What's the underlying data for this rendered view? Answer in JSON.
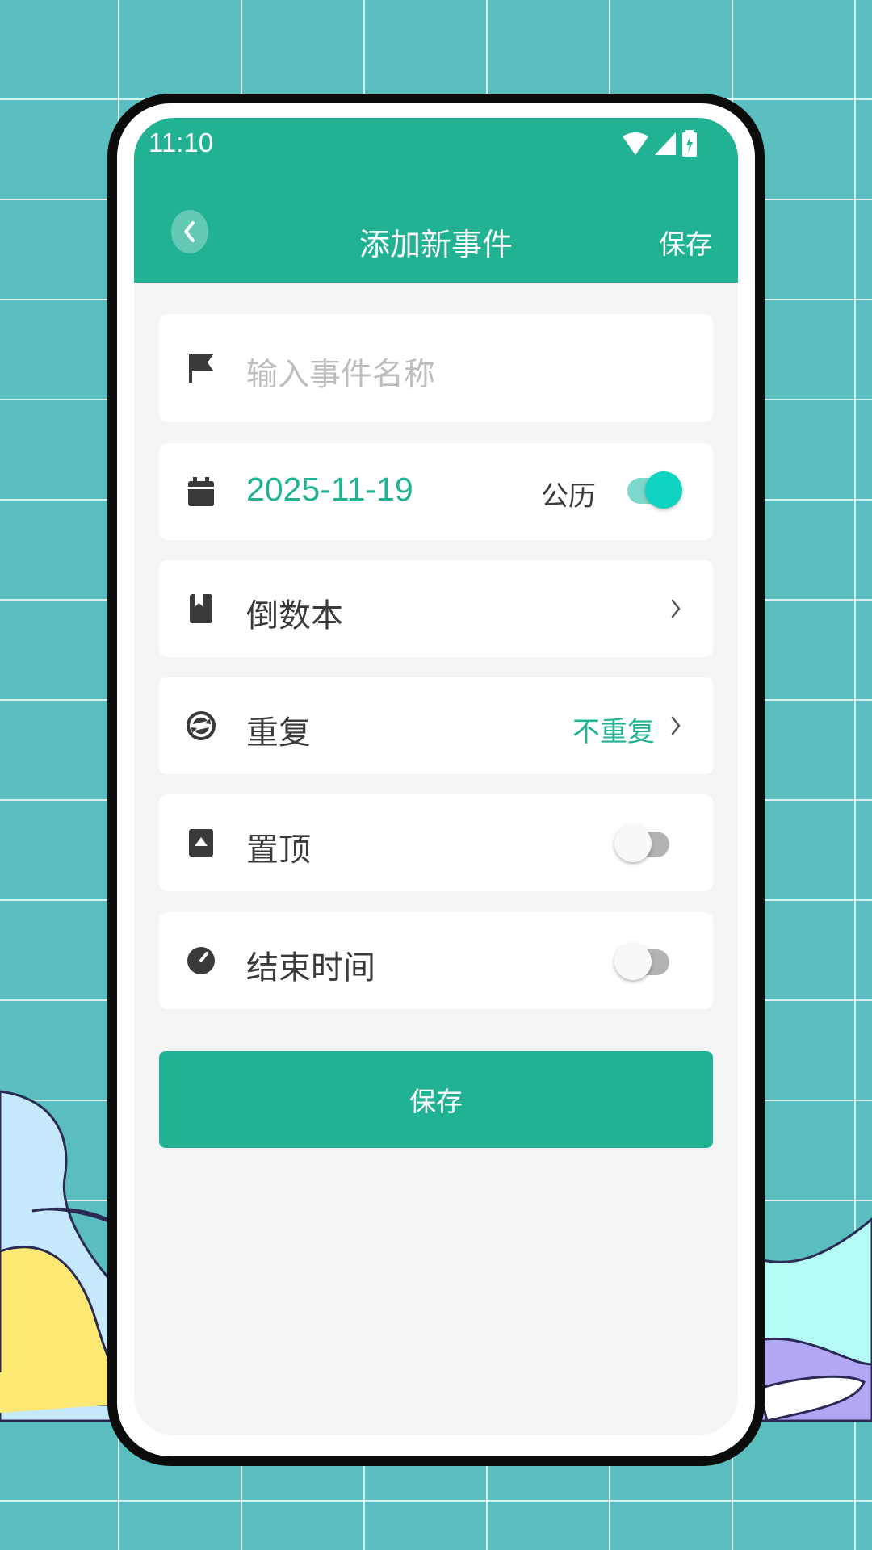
{
  "status_bar": {
    "time": "11:10",
    "icons": [
      "wifi-icon",
      "cell-signal-icon",
      "battery-charging-icon"
    ]
  },
  "header": {
    "title": "添加新事件",
    "save_label": "保存",
    "back_icon": "chevron-left-icon"
  },
  "form": {
    "name": {
      "icon": "flag-icon",
      "placeholder": "输入事件名称",
      "value": ""
    },
    "date": {
      "icon": "calendar-icon",
      "value": "2025-11-19",
      "calendar_label": "公历",
      "calendar_toggle_on": true
    },
    "notebook": {
      "icon": "book-icon",
      "label": "倒数本",
      "chevron": "chevron-right-icon"
    },
    "repeat": {
      "icon": "repeat-icon",
      "label": "重复",
      "value": "不重复",
      "chevron": "chevron-right-icon"
    },
    "pin_top": {
      "icon": "pin-top-icon",
      "label": "置顶",
      "toggle_on": false
    },
    "end_time": {
      "icon": "clock-icon",
      "label": "结束时间",
      "toggle_on": false
    }
  },
  "save_button": {
    "label": "保存"
  },
  "colors": {
    "accent": "#21b294",
    "toggle_on": "#11d3c1",
    "background_grid": "#5abebe",
    "screen_bg": "#f4f4f4"
  }
}
